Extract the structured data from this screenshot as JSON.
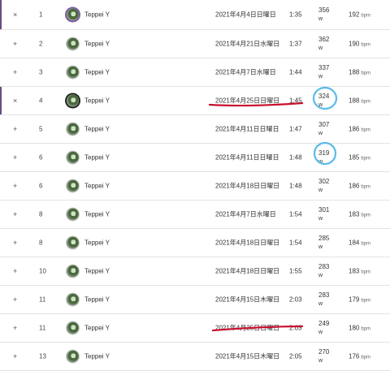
{
  "rows": [
    {
      "sym": "×",
      "rank": "1",
      "name": "Teppei Y",
      "date": "2021年4月4日日曜日",
      "time": "1:35",
      "watts": "356",
      "unit": "w",
      "hr": "192",
      "bpm": "bpm"
    },
    {
      "sym": "+",
      "rank": "2",
      "name": "Teppei Y",
      "date": "2021年4月21日水曜日",
      "time": "1:37",
      "watts": "362",
      "unit": "w",
      "hr": "190",
      "bpm": "bpm"
    },
    {
      "sym": "+",
      "rank": "3",
      "name": "Teppei Y",
      "date": "2021年4月7日水曜日",
      "time": "1:44",
      "watts": "337",
      "unit": "w",
      "hr": "188",
      "bpm": "bpm"
    },
    {
      "sym": "×",
      "rank": "4",
      "name": "Teppei Y",
      "date": "2021年4月25日日曜日",
      "time": "1:45",
      "watts": "324",
      "unit": "w",
      "hr": "188",
      "bpm": "bpm"
    },
    {
      "sym": "+",
      "rank": "5",
      "name": "Teppei Y",
      "date": "2021年4月11日日曜日",
      "time": "1:47",
      "watts": "307",
      "unit": "w",
      "hr": "186",
      "bpm": "bpm"
    },
    {
      "sym": "+",
      "rank": "6",
      "name": "Teppei Y",
      "date": "2021年4月11日日曜日",
      "time": "1:48",
      "watts": "319",
      "unit": "w",
      "hr": "185",
      "bpm": "bpm"
    },
    {
      "sym": "+",
      "rank": "6",
      "name": "Teppei Y",
      "date": "2021年4月18日日曜日",
      "time": "1:48",
      "watts": "302",
      "unit": "w",
      "hr": "186",
      "bpm": "bpm"
    },
    {
      "sym": "+",
      "rank": "8",
      "name": "Teppei Y",
      "date": "2021年4月7日水曜日",
      "time": "1:54",
      "watts": "301",
      "unit": "w",
      "hr": "183",
      "bpm": "bpm"
    },
    {
      "sym": "+",
      "rank": "8",
      "name": "Teppei Y",
      "date": "2021年4月18日日曜日",
      "time": "1:54",
      "watts": "285",
      "unit": "w",
      "hr": "184",
      "bpm": "bpm"
    },
    {
      "sym": "+",
      "rank": "10",
      "name": "Teppei Y",
      "date": "2021年4月18日日曜日",
      "time": "1:55",
      "watts": "283",
      "unit": "w",
      "hr": "183",
      "bpm": "bpm"
    },
    {
      "sym": "+",
      "rank": "11",
      "name": "Teppei Y",
      "date": "2021年4月15日木曜日",
      "time": "2:03",
      "watts": "283",
      "unit": "w",
      "hr": "179",
      "bpm": "bpm"
    },
    {
      "sym": "+",
      "rank": "11",
      "name": "Teppei Y",
      "date": "2021年4月25日日曜日",
      "time": "2:03",
      "watts": "249",
      "unit": "w",
      "hr": "180",
      "bpm": "bpm"
    },
    {
      "sym": "+",
      "rank": "13",
      "name": "Teppei Y",
      "date": "2021年4月15日木曜日",
      "time": "2:05",
      "watts": "270",
      "unit": "w",
      "hr": "176",
      "bpm": "bpm"
    }
  ],
  "annotations": {
    "underline_color": "#c8102e",
    "circle_color": "#5bbbe8"
  }
}
